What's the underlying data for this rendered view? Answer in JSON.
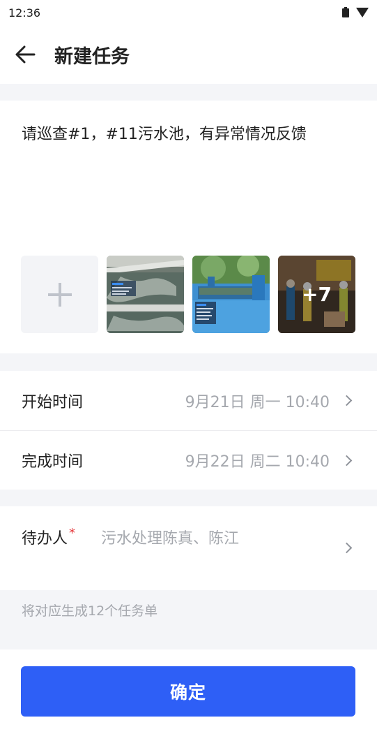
{
  "status_bar": {
    "time": "12:36",
    "icons": [
      "battery-icon",
      "signal-icon"
    ]
  },
  "header": {
    "back_icon": "arrow-left-icon",
    "title": "新建任务"
  },
  "task": {
    "description": "请巡查#1，#11污水池，有异常情况反馈",
    "add_photo_icon": "plus-icon",
    "photos": [
      {
        "name": "sewage-tank-photo"
      },
      {
        "name": "blue-tank-photo"
      },
      {
        "name": "workers-photo",
        "more_count": "+7"
      }
    ]
  },
  "schedule": {
    "start": {
      "label": "开始时间",
      "value": "9月21日  周一 10:40"
    },
    "finish": {
      "label": "完成时间",
      "value": "9月22日  周二  10:40"
    }
  },
  "assignee": {
    "label": "待办人",
    "required_mark": "*",
    "value": "污水处理陈真、陈江"
  },
  "hint": "将对应生成12个任务单",
  "confirm_label": "确定",
  "colors": {
    "primary": "#2e5ff6",
    "required": "#e5383b",
    "muted_text": "#a5a8ae",
    "background": "#f4f5f8"
  }
}
